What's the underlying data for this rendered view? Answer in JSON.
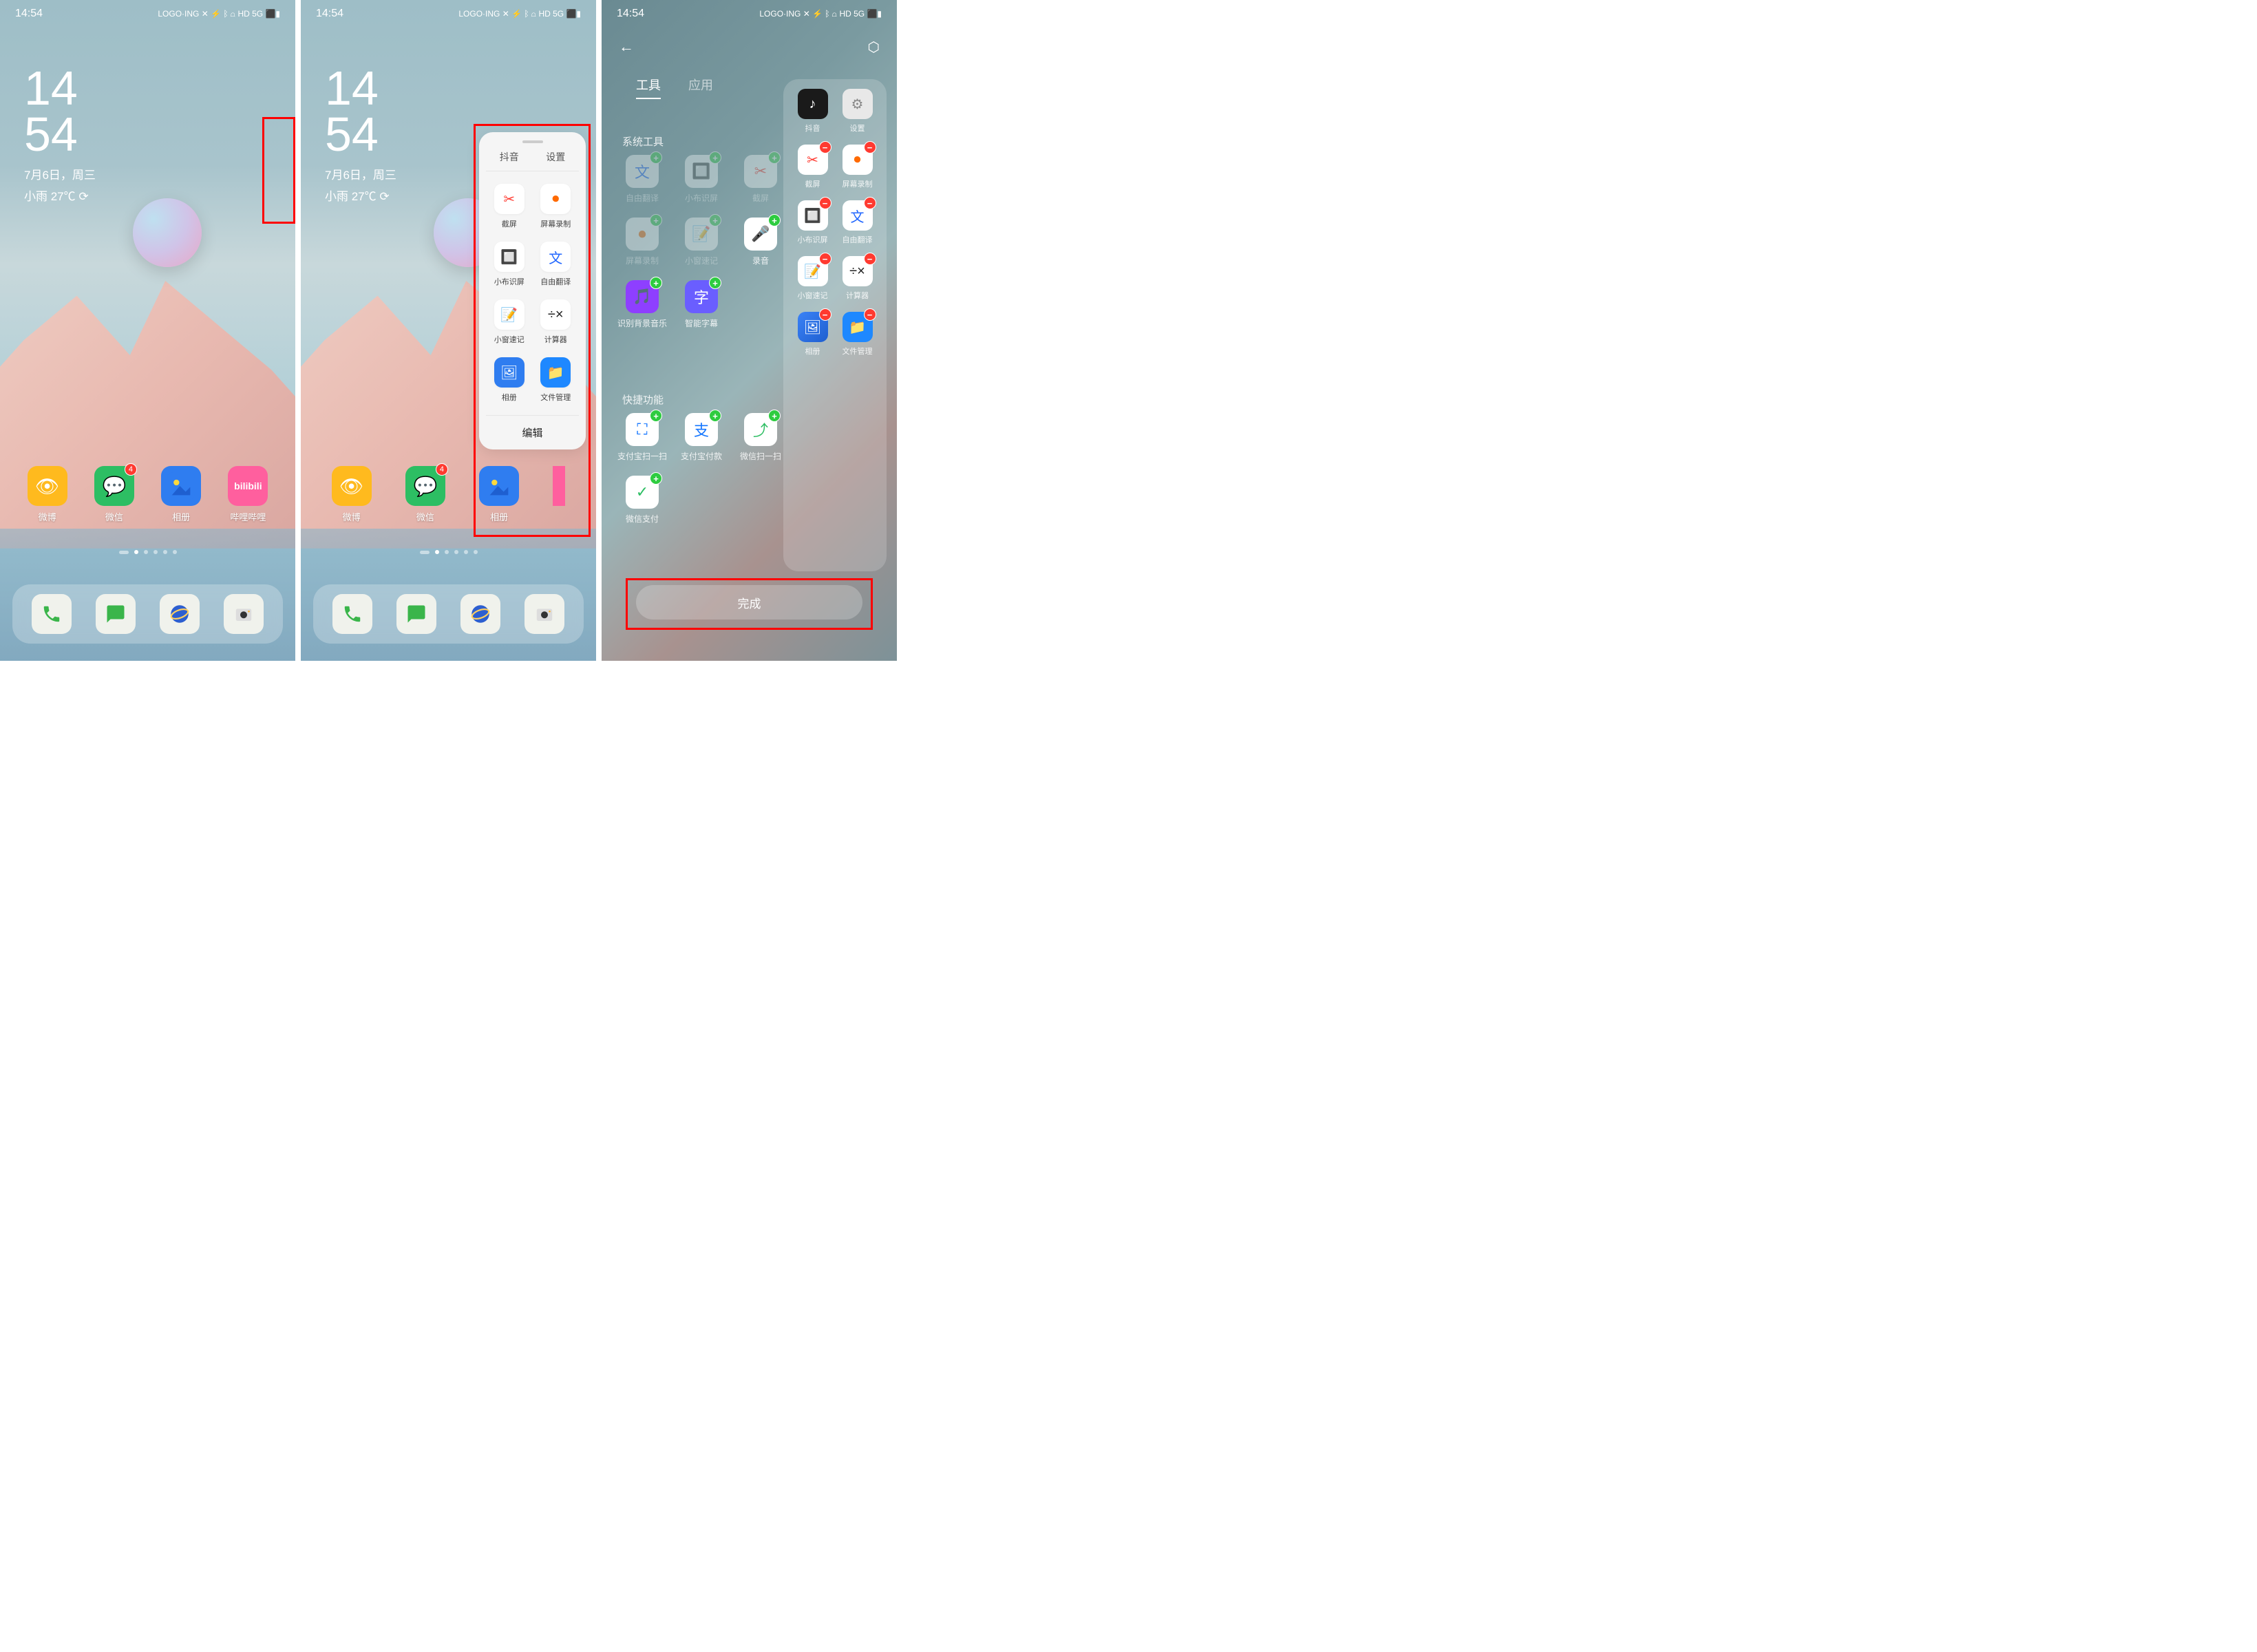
{
  "status": {
    "time": "14:54",
    "icons_text": "LOGO·ING ✕ ⚡ ᛒ ⩍ HD 5G ⬛▮"
  },
  "clock": {
    "hh": "14",
    "mm": "54",
    "date": "7月6日，周三",
    "weather": "小雨 27℃ ⟳"
  },
  "home_apps": [
    {
      "label": "微博",
      "badge": null,
      "bg": "#ffba1e",
      "glyph": "👁"
    },
    {
      "label": "微信",
      "badge": "4",
      "bg": "#2dbe63",
      "glyph": "💬"
    },
    {
      "label": "相册",
      "badge": null,
      "bg": "#2f7df0",
      "glyph": "🖼"
    },
    {
      "label": "哔哩哔哩",
      "badge": null,
      "bg": "#ff5f9e",
      "glyph": "bili"
    }
  ],
  "dock": [
    {
      "bg": "#f0f2ec",
      "fg": "#3ab54a",
      "glyph": "phone"
    },
    {
      "bg": "#f0f2ec",
      "fg": "#3ab54a",
      "glyph": "chat"
    },
    {
      "bg": "#f0f2ec",
      "fg": "#2d5fd0",
      "glyph": "browser"
    },
    {
      "bg": "#f0f2ec",
      "fg": "#333",
      "glyph": "camera"
    }
  ],
  "sidebar": {
    "tabs": [
      "抖音",
      "设置"
    ],
    "items": [
      {
        "label": "截屏",
        "glyph": "✂",
        "color": "#ff3a30"
      },
      {
        "label": "屏幕录制",
        "glyph": "⏺",
        "color": "#ff6a00"
      },
      {
        "label": "小布识屏",
        "glyph": "🔲",
        "color": "#4a6df5"
      },
      {
        "label": "自由翻译",
        "glyph": "文",
        "color": "#2066ff"
      },
      {
        "label": "小窗速记",
        "glyph": "📝",
        "color": "#ffb020"
      },
      {
        "label": "计算器",
        "glyph": "÷×",
        "color": "#222"
      },
      {
        "label": "相册",
        "glyph": "🖼",
        "color": "#2f7df0",
        "filled": true
      },
      {
        "label": "文件管理",
        "glyph": "📁",
        "color": "#1e88ff",
        "filled": true
      }
    ],
    "edit": "编辑"
  },
  "editor": {
    "tabs": {
      "tools": "工具",
      "apps": "应用"
    },
    "section_system": "系统工具",
    "section_shortcut": "快捷功能",
    "system_tools": [
      {
        "label": "自由翻译",
        "bg": "#fff",
        "fg": "#2066ff",
        "glyph": "文",
        "dim": true,
        "badge": "plus"
      },
      {
        "label": "小布识屏",
        "bg": "#fff",
        "fg": "#4a6df5",
        "glyph": "🔲",
        "dim": true,
        "badge": "plus"
      },
      {
        "label": "截屏",
        "bg": "#fff",
        "fg": "#ff3a30",
        "glyph": "✂",
        "dim": true,
        "badge": "plus"
      },
      {
        "label": "屏幕录制",
        "bg": "#fff",
        "fg": "#ff6a00",
        "glyph": "⏺",
        "dim": true,
        "badge": "plus"
      },
      {
        "label": "小窗速记",
        "bg": "#fff",
        "fg": "#ffb020",
        "glyph": "📝",
        "dim": true,
        "badge": "plus"
      },
      {
        "label": "录音",
        "bg": "#fff",
        "fg": "#ff3a30",
        "glyph": "🎤",
        "dim": false,
        "badge": "plus"
      },
      {
        "label": "识别背景音乐",
        "bg": "#8e3fff",
        "fg": "#fff",
        "glyph": "🎵",
        "dim": false,
        "badge": "plus"
      },
      {
        "label": "智能字幕",
        "bg": "#6a5eff",
        "fg": "#fff",
        "glyph": "字",
        "dim": false,
        "badge": "plus"
      }
    ],
    "shortcuts": [
      {
        "label": "支付宝扫一扫",
        "bg": "#fff",
        "fg": "#1677ff",
        "glyph": "⛶",
        "badge": "plus"
      },
      {
        "label": "支付宝付款",
        "bg": "#fff",
        "fg": "#1677ff",
        "glyph": "支",
        "badge": "plus"
      },
      {
        "label": "微信扫一扫",
        "bg": "#fff",
        "fg": "#2dbe63",
        "glyph": "⤴",
        "badge": "plus"
      },
      {
        "label": "微信支付",
        "bg": "#fff",
        "fg": "#2dbe63",
        "glyph": "✓",
        "badge": "plus"
      }
    ],
    "selected_top": [
      {
        "label": "抖音",
        "bg": "#1a1a1a",
        "fg": "#fff",
        "glyph": "♪"
      },
      {
        "label": "设置",
        "bg": "#e8e8e8",
        "fg": "#888",
        "glyph": "⚙"
      }
    ],
    "selected": [
      {
        "label": "截屏",
        "bg": "#fff",
        "fg": "#ff3a30",
        "glyph": "✂"
      },
      {
        "label": "屏幕录制",
        "bg": "#fff",
        "fg": "#ff6a00",
        "glyph": "⏺"
      },
      {
        "label": "小布识屏",
        "bg": "#fff",
        "fg": "#4a6df5",
        "glyph": "🔲"
      },
      {
        "label": "自由翻译",
        "bg": "#fff",
        "fg": "#2066ff",
        "glyph": "文"
      },
      {
        "label": "小窗速记",
        "bg": "#fff",
        "fg": "#ffb020",
        "glyph": "📝"
      },
      {
        "label": "计算器",
        "bg": "#fff",
        "fg": "#222",
        "glyph": "÷×"
      },
      {
        "label": "相册",
        "bg": "linear-gradient(135deg,#3b82f6,#1e5fd0)",
        "fg": "#fff",
        "glyph": "🖼"
      },
      {
        "label": "文件管理",
        "bg": "#1e88ff",
        "fg": "#fff",
        "glyph": "📁"
      }
    ],
    "done": "完成"
  }
}
